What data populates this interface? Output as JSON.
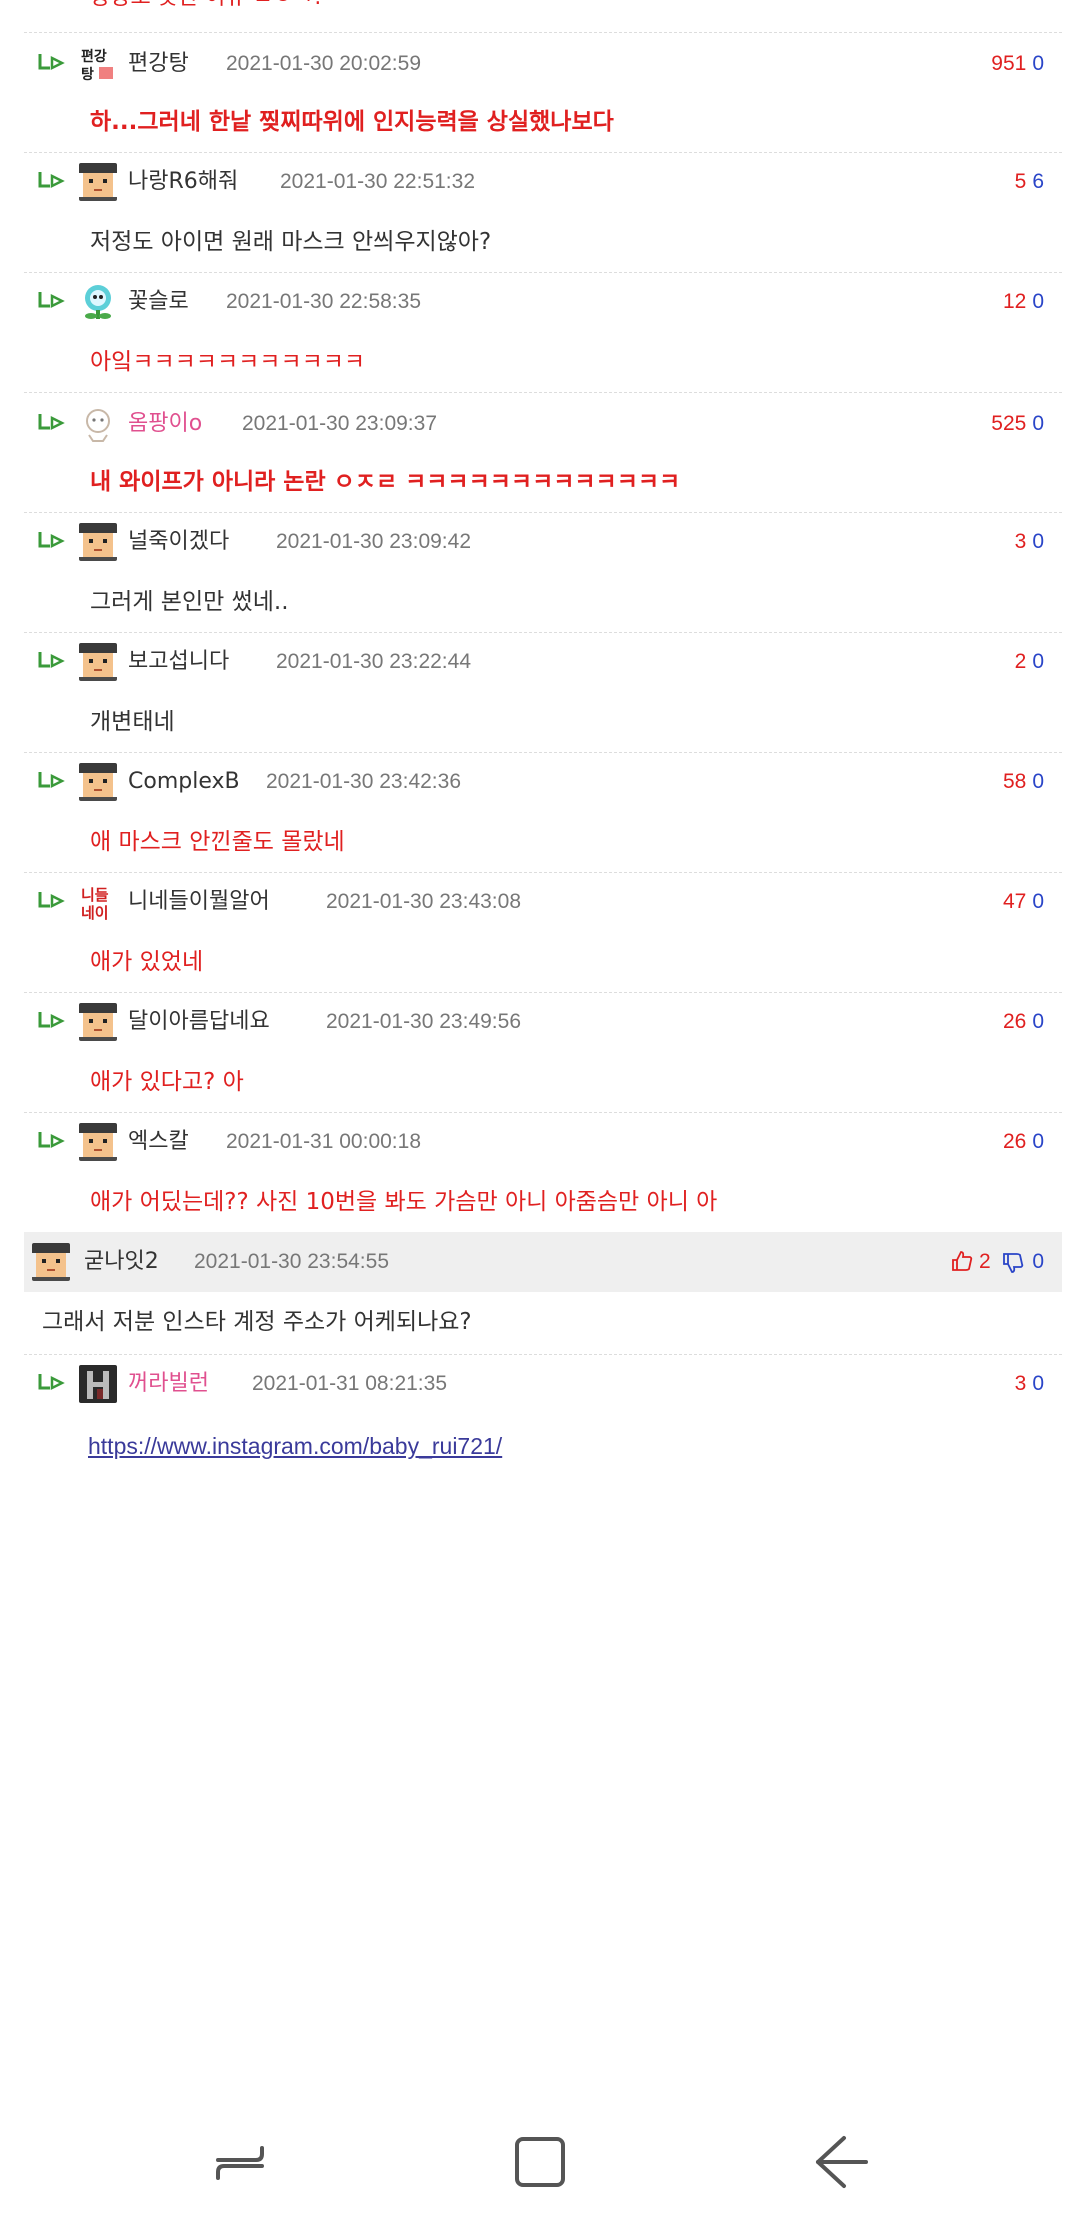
{
  "top_fragment": "상상도 못한 이유 ㄴㅇㄱ!",
  "comments": [
    {
      "nick": "편강탕",
      "date": "2021-01-30 20:02:59",
      "up": "951",
      "down": "0",
      "text": "하...그러네 한낱 찢찌따위에 인지능력을 상실했나보다"
    },
    {
      "nick": "나랑R6해줘",
      "date": "2021-01-30 22:51:32",
      "up": "5",
      "down": "6",
      "text": "저정도 아이면 원래 마스크 안씌우지않아?"
    },
    {
      "nick": "꽃슬로",
      "date": "2021-01-30 22:58:35",
      "up": "12",
      "down": "0",
      "text": "아잌ㅋㅋㅋㅋㅋㅋㅋㅋㅋㅋㅋ"
    },
    {
      "nick": "옴팡이o",
      "date": "2021-01-30 23:09:37",
      "up": "525",
      "down": "0",
      "text": "내 와이프가 아니라 논란 ㅇㅈㄹ ㅋㅋㅋㅋㅋㅋㅋㅋㅋㅋㅋㅋㅋ"
    },
    {
      "nick": "널죽이겠다",
      "date": "2021-01-30 23:09:42",
      "up": "3",
      "down": "0",
      "text": "그러게 본인만 썼네.."
    },
    {
      "nick": "보고섭니다",
      "date": "2021-01-30 23:22:44",
      "up": "2",
      "down": "0",
      "text": "개변태네"
    },
    {
      "nick": "ComplexB",
      "date": "2021-01-30 23:42:36",
      "up": "58",
      "down": "0",
      "text": "애 마스크 안낀줄도 몰랐네"
    },
    {
      "nick": "니네들이뭘알어",
      "date": "2021-01-30 23:43:08",
      "up": "47",
      "down": "0",
      "text": "애가 있었네"
    },
    {
      "nick": "달이아름답네요",
      "date": "2021-01-30 23:49:56",
      "up": "26",
      "down": "0",
      "text": "애가 있다고? 아"
    },
    {
      "nick": "엑스칼",
      "date": "2021-01-31 00:00:18",
      "up": "26",
      "down": "0",
      "text": "애가 어딨는데?? 사진 10번을 봐도 가슴만 아니 아줌슴만 아니 아"
    }
  ],
  "parent": {
    "nick": "굳나잇2",
    "date": "2021-01-30 23:54:55",
    "up": "2",
    "down": "0",
    "text": "그래서 저분 인스타 계정 주소가 어케되나요?"
  },
  "last_reply": {
    "nick": "꺼라빌런",
    "date": "2021-01-31 08:21:35",
    "up": "3",
    "down": "0",
    "link": "https://www.instagram.com/baby_rui721/"
  },
  "colors": {
    "up_red": "#e02020",
    "down_blue": "#2a45c8",
    "arrow_green": "#3a9a3a",
    "pink_nick": "#e0508f"
  },
  "icons": {
    "reply": "reply-arrow-icon",
    "thumb_up": "thumb-up-icon",
    "thumb_down": "thumb-down-icon",
    "nav_recent": "recent-apps-icon",
    "nav_home": "home-icon",
    "nav_back": "back-icon"
  }
}
